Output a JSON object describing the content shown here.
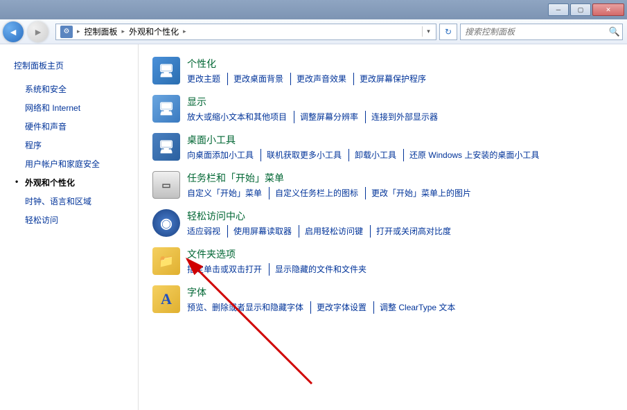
{
  "titlebar": {
    "min_tip": "最小化",
    "max_tip": "最大化",
    "close_tip": "关闭"
  },
  "nav": {
    "crumb_root": "控制面板",
    "crumb_current": "外观和个性化",
    "refresh_tip": "刷新",
    "search_placeholder": "搜索控制面板"
  },
  "sidebar": {
    "head": "控制面板主页",
    "items": [
      {
        "label": "系统和安全",
        "current": false
      },
      {
        "label": "网络和 Internet",
        "current": false
      },
      {
        "label": "硬件和声音",
        "current": false
      },
      {
        "label": "程序",
        "current": false
      },
      {
        "label": "用户帐户和家庭安全",
        "current": false
      },
      {
        "label": "外观和个性化",
        "current": true
      },
      {
        "label": "时钟、语言和区域",
        "current": false
      },
      {
        "label": "轻松访问",
        "current": false
      }
    ]
  },
  "categories": [
    {
      "icon": "personalize-icon",
      "glyph": "🖥",
      "title": "个性化",
      "links": [
        "更改主题",
        "更改桌面背景",
        "更改声音效果",
        "更改屏幕保护程序"
      ]
    },
    {
      "icon": "display-icon",
      "glyph": "🖥",
      "title": "显示",
      "links": [
        "放大或缩小文本和其他项目",
        "调整屏幕分辨率",
        "连接到外部显示器"
      ]
    },
    {
      "icon": "gadgets-icon",
      "glyph": "🖥",
      "title": "桌面小工具",
      "links": [
        "向桌面添加小工具",
        "联机获取更多小工具",
        "卸载小工具",
        "还原 Windows 上安装的桌面小工具"
      ]
    },
    {
      "icon": "taskbar-icon",
      "glyph": "▭",
      "title": "任务栏和「开始」菜单",
      "links": [
        "自定义「开始」菜单",
        "自定义任务栏上的图标",
        "更改「开始」菜单上的图片"
      ]
    },
    {
      "icon": "ease-icon",
      "glyph": "◉",
      "title": "轻松访问中心",
      "links": [
        "适应弱视",
        "使用屏幕读取器",
        "启用轻松访问键",
        "打开或关闭高对比度"
      ]
    },
    {
      "icon": "folder-icon",
      "glyph": "📁",
      "title": "文件夹选项",
      "links": [
        "指定单击或双击打开",
        "显示隐藏的文件和文件夹"
      ]
    },
    {
      "icon": "fonts-icon",
      "glyph": "A",
      "title": "字体",
      "links": [
        "预览、删除或者显示和隐藏字体",
        "更改字体设置",
        "调整 ClearType 文本"
      ]
    }
  ]
}
